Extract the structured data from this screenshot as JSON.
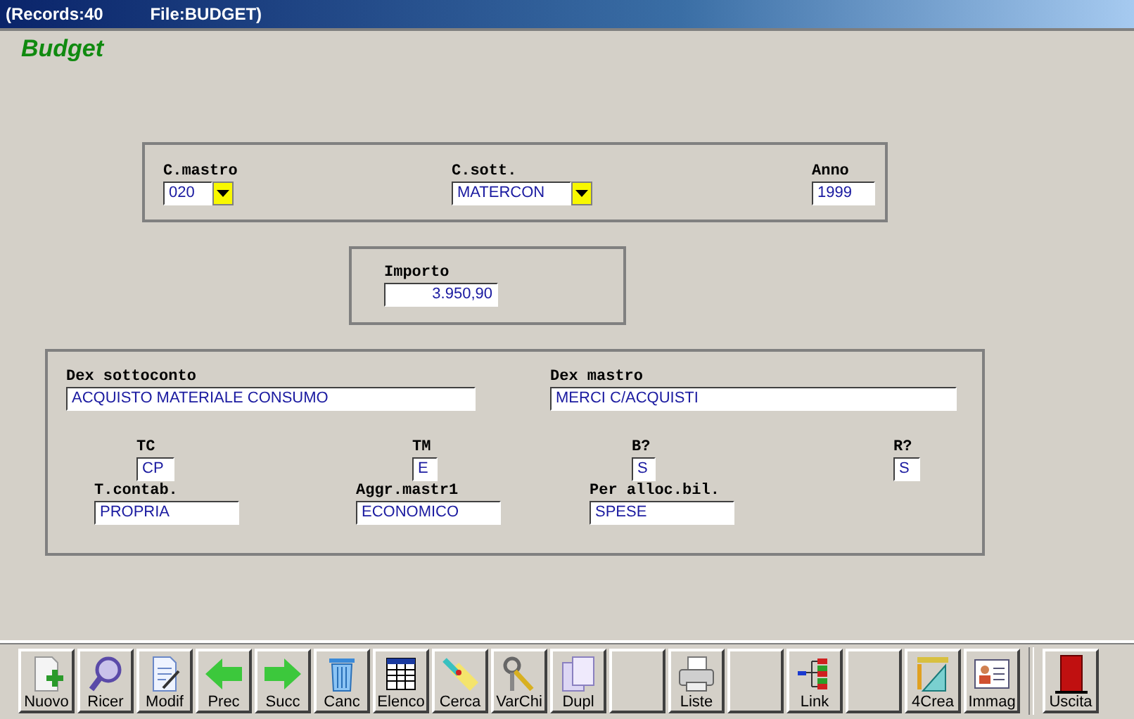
{
  "window": {
    "title": "(Records:40          File:BUDGET)"
  },
  "form_title": "Budget",
  "groups": [
    {
      "lines": [
        [
          {
            "label": "C.mastro",
            "value": "020",
            "kind": "combo"
          },
          {
            "label": "C.sott.",
            "value": "MATERCON",
            "kind": "combo"
          },
          {
            "label": "Anno",
            "value": "1999",
            "kind": "text"
          }
        ]
      ]
    },
    {
      "lines": [
        [
          {
            "label": "Importo",
            "value": "3.950,90",
            "kind": "amount"
          }
        ]
      ]
    },
    {
      "lines": [
        [
          {
            "label": "Dex sottoconto",
            "value": "ACQUISTO MATERIALE CONSUMO",
            "kind": "text"
          },
          {
            "label": "Dex mastro",
            "value": "MERCI C/ACQUISTI",
            "kind": "text"
          }
        ],
        [
          {
            "label": "TC",
            "value": "CP",
            "kind": "text"
          },
          {
            "label": "TM",
            "value": "E",
            "kind": "text"
          },
          {
            "label": "B?",
            "value": "S",
            "kind": "text"
          },
          {
            "label": "R?",
            "value": "S",
            "kind": "text"
          }
        ],
        [
          {
            "label": "T.contab.",
            "value": "PROPRIA",
            "kind": "text"
          },
          {
            "label": "Aggr.mastr1",
            "value": "ECONOMICO",
            "kind": "text"
          },
          {
            "label": "Per alloc.bil.",
            "value": "SPESE",
            "kind": "text"
          }
        ]
      ]
    }
  ],
  "toolbar": [
    {
      "label": "Nuovo",
      "kind": "new"
    },
    {
      "label": "Ricer",
      "kind": "search"
    },
    {
      "label": "Modif",
      "kind": "edit"
    },
    {
      "label": "Prec",
      "kind": "prev"
    },
    {
      "label": "Succ",
      "kind": "next"
    },
    {
      "label": "Canc",
      "kind": "delete"
    },
    {
      "label": "Elenco",
      "kind": "list"
    },
    {
      "label": "Cerca",
      "kind": "find"
    },
    {
      "label": "VarChi",
      "kind": "keys"
    },
    {
      "label": "Dupl",
      "kind": "copy"
    },
    {
      "kind": "blank"
    },
    {
      "label": "Liste",
      "kind": "print"
    },
    {
      "kind": "blank"
    },
    {
      "label": "Link",
      "kind": "link"
    },
    {
      "kind": "blank"
    },
    {
      "label": "4Crea",
      "kind": "create"
    },
    {
      "label": "Immag",
      "kind": "image"
    },
    {
      "label": "Uscita",
      "kind": "exit"
    }
  ]
}
